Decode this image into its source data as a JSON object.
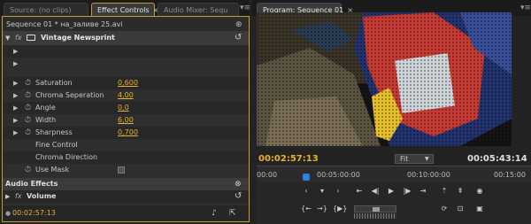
{
  "left_tabs": {
    "source": "Source: (no clips)",
    "effect_controls": "Effect Controls",
    "audio_mixer": "Audio Mixer: Sequ"
  },
  "right_tabs": {
    "program": "Program: Sequence 01"
  },
  "clip_path": "Sequence 01 * на_заливе 25.avi",
  "effect": {
    "name": "Vintage Newsprint"
  },
  "params": [
    {
      "label": "Saturation",
      "value": "0,600"
    },
    {
      "label": "Chroma Seperation",
      "value": "4,00"
    },
    {
      "label": "Angle",
      "value": "0,0"
    },
    {
      "label": "Width",
      "value": "6,00"
    },
    {
      "label": "Sharpness",
      "value": "0,700"
    }
  ],
  "options": [
    "Fine Control",
    "Chroma Direction",
    "Use Mask"
  ],
  "audio_effects": "Audio Effects",
  "volume": "Volume",
  "left_timecode": "00:02:57:13",
  "program": {
    "current_time": "00:02:57:13",
    "fit": "Fit",
    "duration": "00:05:43:14",
    "ruler": [
      "00:00",
      "00:05:00:00",
      "00:10:00:00",
      "00:15:00"
    ]
  },
  "colors": {
    "accent": "#e7b22c",
    "panel_border": "#c59d2c"
  }
}
